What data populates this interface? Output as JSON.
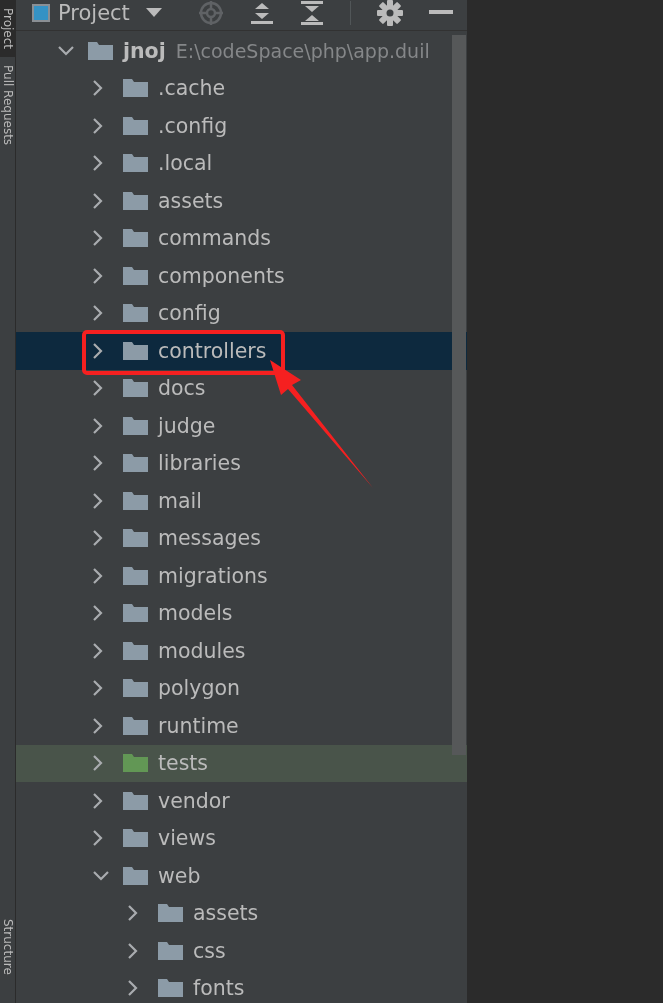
{
  "tool_strip": {
    "tabs": [
      {
        "label": "Project",
        "selected": true
      },
      {
        "label": "Pull Requests",
        "selected": false
      }
    ],
    "bottom_tabs": [
      {
        "label": "Structure",
        "selected": false
      }
    ]
  },
  "panel": {
    "title": "Project"
  },
  "tree": [
    {
      "name": "jnoj",
      "path": "E:\\codeSpace\\php\\app.duil",
      "kind": "folder",
      "expanded": true,
      "selected": false,
      "children": [
        {
          "name": ".cache",
          "kind": "folder",
          "expanded": false,
          "selected": false
        },
        {
          "name": ".config",
          "kind": "folder",
          "expanded": false,
          "selected": false
        },
        {
          "name": ".local",
          "kind": "folder",
          "expanded": false,
          "selected": false
        },
        {
          "name": "assets",
          "kind": "folder",
          "expanded": false,
          "selected": false
        },
        {
          "name": "commands",
          "kind": "folder",
          "expanded": false,
          "selected": false
        },
        {
          "name": "components",
          "kind": "folder",
          "expanded": false,
          "selected": false
        },
        {
          "name": "config",
          "kind": "folder",
          "expanded": false,
          "selected": false
        },
        {
          "name": "controllers",
          "kind": "folder",
          "expanded": false,
          "selected": true
        },
        {
          "name": "docs",
          "kind": "folder",
          "expanded": false,
          "selected": false
        },
        {
          "name": "judge",
          "kind": "folder",
          "expanded": false,
          "selected": false
        },
        {
          "name": "libraries",
          "kind": "folder",
          "expanded": false,
          "selected": false
        },
        {
          "name": "mail",
          "kind": "folder",
          "expanded": false,
          "selected": false
        },
        {
          "name": "messages",
          "kind": "folder",
          "expanded": false,
          "selected": false
        },
        {
          "name": "migrations",
          "kind": "folder",
          "expanded": false,
          "selected": false
        },
        {
          "name": "models",
          "kind": "folder",
          "expanded": false,
          "selected": false
        },
        {
          "name": "modules",
          "kind": "folder",
          "expanded": false,
          "selected": false
        },
        {
          "name": "polygon",
          "kind": "folder",
          "expanded": false,
          "selected": false
        },
        {
          "name": "runtime",
          "kind": "folder",
          "expanded": false,
          "selected": false
        },
        {
          "name": "tests",
          "kind": "test",
          "expanded": false,
          "selected": false
        },
        {
          "name": "vendor",
          "kind": "folder",
          "expanded": false,
          "selected": false
        },
        {
          "name": "views",
          "kind": "folder",
          "expanded": false,
          "selected": false
        },
        {
          "name": "web",
          "kind": "folder",
          "expanded": true,
          "selected": false,
          "children": [
            {
              "name": "assets",
              "kind": "folder",
              "expanded": false,
              "selected": false
            },
            {
              "name": "css",
              "kind": "folder",
              "expanded": false,
              "selected": false
            },
            {
              "name": "fonts",
              "kind": "folder",
              "expanded": false,
              "selected": false
            }
          ]
        }
      ]
    }
  ]
}
